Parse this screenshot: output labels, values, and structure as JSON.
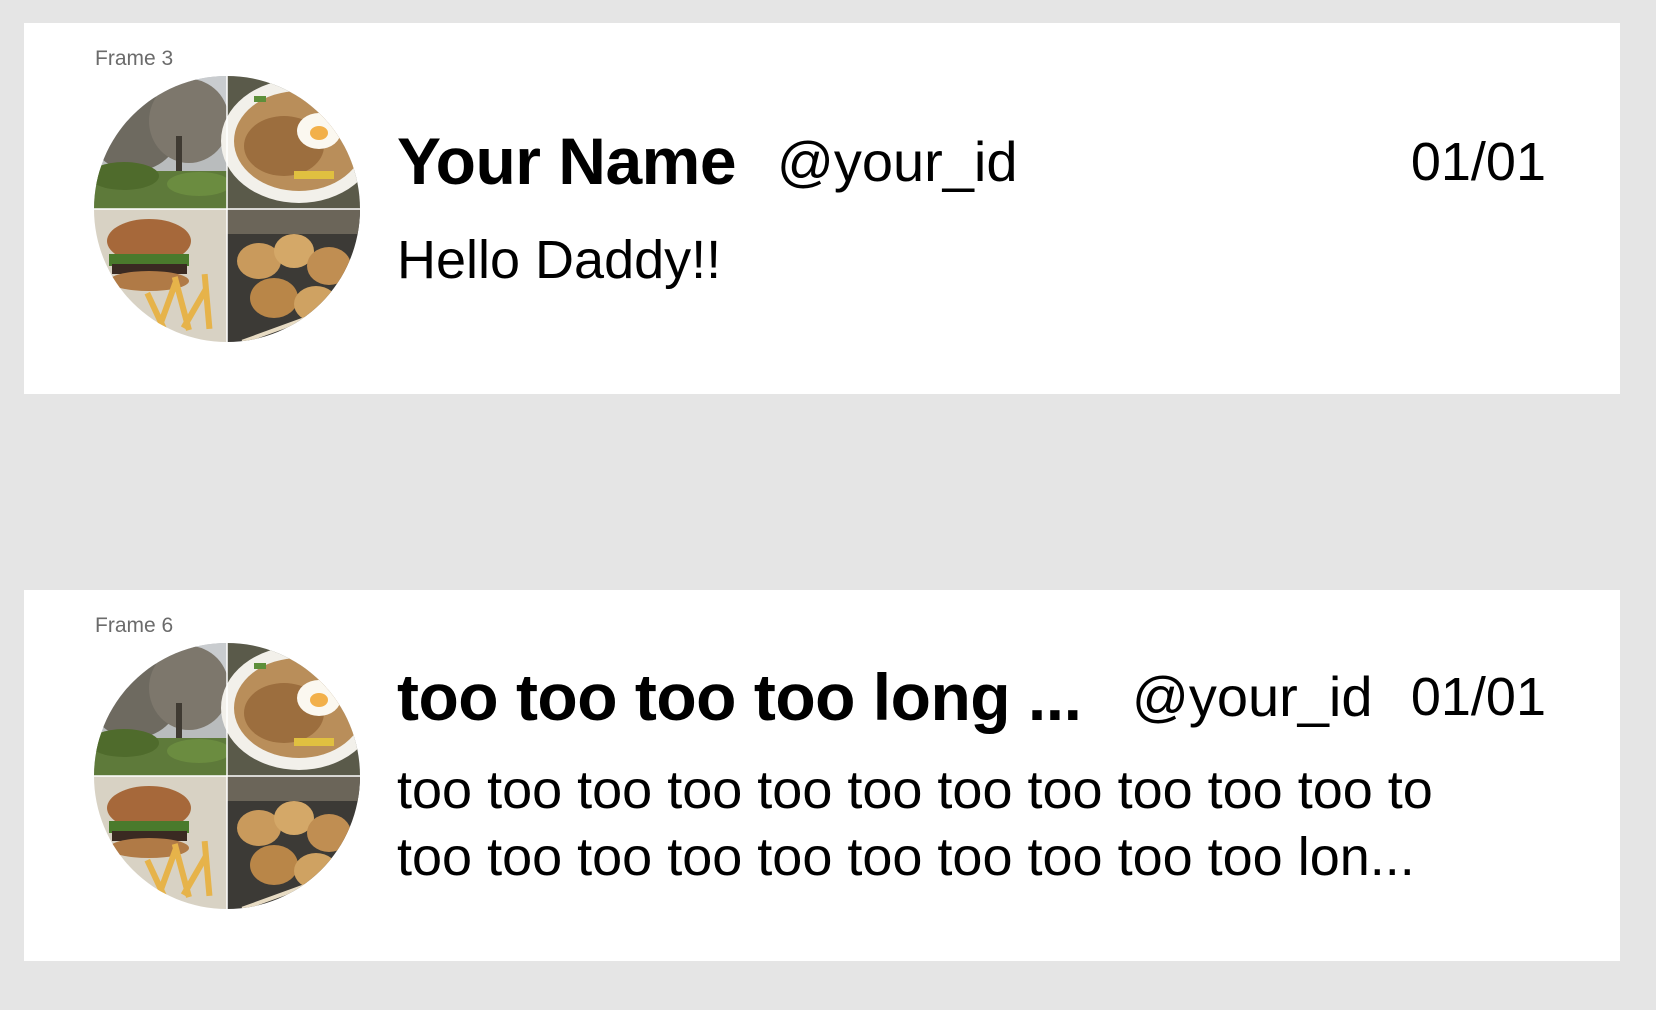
{
  "frames": [
    {
      "label": "Frame 3",
      "name": "Your Name",
      "handle": "@your_id",
      "date": "01/01",
      "message": "Hello Daddy!!"
    },
    {
      "label": "Frame 6",
      "name": "too too too too long ...",
      "handle": "@your_id",
      "date": "01/01",
      "message": "too too too too too too too too too too too to\ntoo too too too too too too too too too lon..."
    }
  ],
  "avatar": {
    "quadrants": [
      "park-trees-photo",
      "fried-rice-egg-photo",
      "burger-fries-photo",
      "kushikatsu-photo"
    ]
  },
  "colors": {
    "background": "#e5e5e5",
    "card": "#ffffff",
    "frame_label": "#6b6b6b",
    "text": "#000000"
  }
}
